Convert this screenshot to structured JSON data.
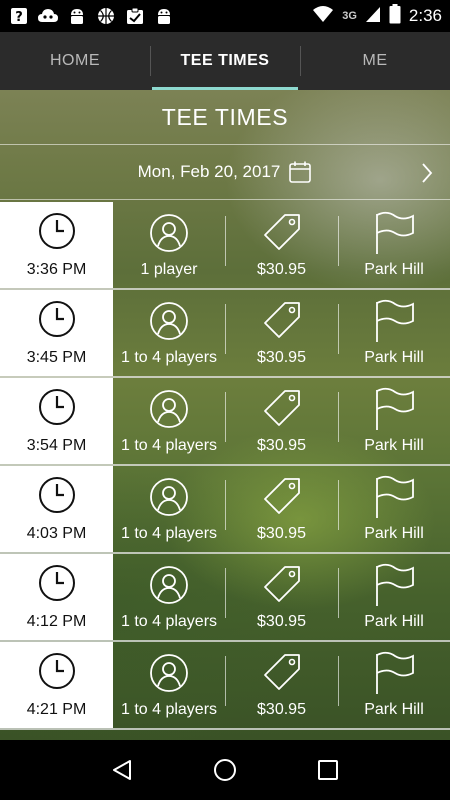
{
  "status_bar": {
    "time": "2:36",
    "network": "3G",
    "notification_icons": [
      "help-icon",
      "cloud-icon",
      "android-icon",
      "basketball-icon",
      "checklist-icon",
      "android-icon"
    ]
  },
  "tabs": [
    {
      "label": "HOME",
      "active": false
    },
    {
      "label": "TEE TIMES",
      "active": true
    },
    {
      "label": "ME",
      "active": false
    }
  ],
  "page_title": "TEE TIMES",
  "date": "Mon, Feb 20, 2017",
  "tee_times": [
    {
      "time": "3:36 PM",
      "players": "1 player",
      "price": "$30.95",
      "course": "Park Hill"
    },
    {
      "time": "3:45 PM",
      "players": "1 to 4 players",
      "price": "$30.95",
      "course": "Park Hill"
    },
    {
      "time": "3:54 PM",
      "players": "1 to 4 players",
      "price": "$30.95",
      "course": "Park Hill"
    },
    {
      "time": "4:03 PM",
      "players": "1 to 4 players",
      "price": "$30.95",
      "course": "Park Hill"
    },
    {
      "time": "4:12 PM",
      "players": "1 to 4 players",
      "price": "$30.95",
      "course": "Park Hill"
    },
    {
      "time": "4:21 PM",
      "players": "1 to 4 players",
      "price": "$30.95",
      "course": "Park Hill"
    }
  ],
  "colors": {
    "tab_indicator": "#8ed9cf",
    "tab_bar": "#2b2b2b",
    "time_cell": "#ffffff"
  }
}
